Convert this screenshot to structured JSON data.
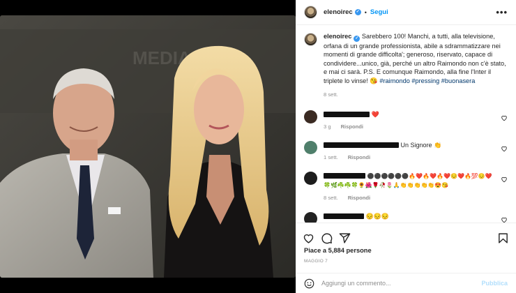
{
  "post": {
    "username": "elenoirec",
    "dot": "•",
    "follow_label": "Segui",
    "more_label": "•••",
    "verified_mark": "✓",
    "caption_text": " Sarebbero 100! Manchi, a tutti, alla televisione, orfana di un grande professionista, abile a sdrammatizzare nei momenti di grande difficolta'; generoso, riservato, capace di condividere...unico, già, perché un altro Raimondo non c'è stato, e mai ci sarà. P.S. E comunque Raimondo, alla fine l'Inter il triplete lo vinse! 😘 ",
    "hashtags": [
      "#raimondo",
      "#pressing",
      "#buonasera"
    ],
    "caption_age": "8 sett.",
    "likes": "Piace a 5,884 persone",
    "date": "MAGGIO 7",
    "comment_placeholder": "Aggiungi un commento...",
    "publish_label": "Pubblica"
  },
  "comments": [
    {
      "text": "❤️",
      "age": "3 g",
      "reply": "Rispondi",
      "avatar_color": "#3a2a22"
    },
    {
      "text": "Un Signore 👏",
      "age": "1 sett.",
      "reply": "Rispondi",
      "avatar_color": "#4f7f6b"
    },
    {
      "text": "⚫⚫⚫⚫⚫⚫🔥❤️🔥❤️🔥❤️😔❤️🔥💯😔❤️🍀🌿☘️☘️🍀🌻🌺🌹🥀🌷🙏👏👏👏👏👏😍😘",
      "age": "8 sett.",
      "reply": "Rispondi",
      "avatar_color": "#1d1d1d"
    },
    {
      "text": "😔😔😔",
      "age": "",
      "reply": "",
      "avatar_color": "#222222"
    }
  ],
  "icons": {
    "like": "heart-icon",
    "comment": "comment-icon",
    "share": "share-icon",
    "save": "bookmark-icon",
    "emoji": "emoji-icon"
  },
  "colors": {
    "accent": "#0095f6",
    "tag": "#00376b",
    "muted": "#8e8e8e"
  }
}
